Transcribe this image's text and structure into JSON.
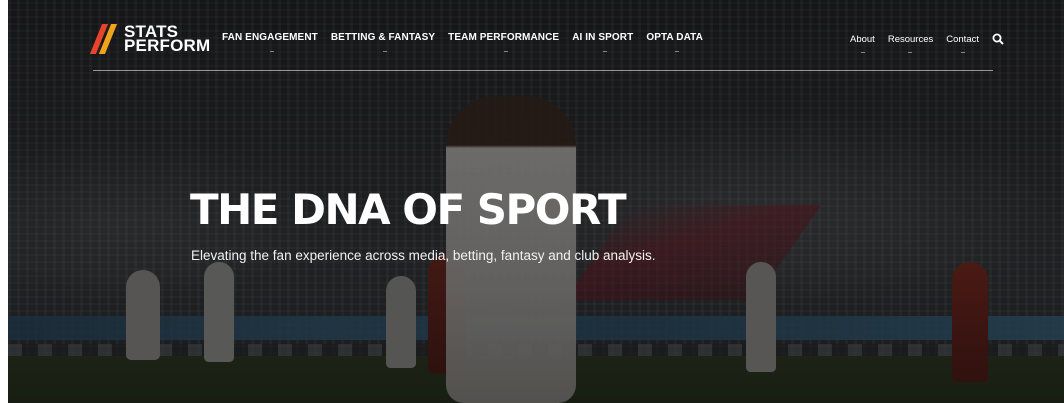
{
  "brand": {
    "line1": "STATS",
    "line2": "PERFORM",
    "colors": {
      "stripe1": "#e8442c",
      "stripe2": "#f2a31c"
    }
  },
  "nav": {
    "main": [
      {
        "label": "FAN ENGAGEMENT"
      },
      {
        "label": "BETTING & FANTASY"
      },
      {
        "label": "TEAM PERFORMANCE"
      },
      {
        "label": "AI IN SPORT"
      },
      {
        "label": "OPTA DATA"
      }
    ],
    "secondary": [
      {
        "label": "About"
      },
      {
        "label": "Resources"
      },
      {
        "label": "Contact"
      }
    ],
    "search_icon": "search-icon"
  },
  "hero": {
    "headline": "THE DNA OF SPORT",
    "subheadline": "Elevating the fan experience across media, betting, fantasy and club analysis."
  }
}
